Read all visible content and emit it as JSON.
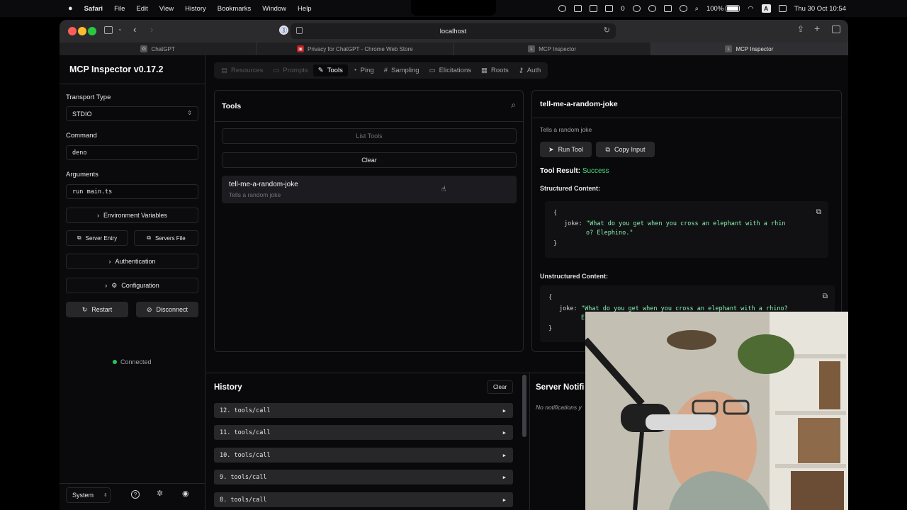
{
  "menubar": {
    "apple": "",
    "app_name": "Safari",
    "items": [
      "File",
      "Edit",
      "View",
      "History",
      "Bookmarks",
      "Window",
      "Help"
    ],
    "badge": "0",
    "battery": "100%",
    "input_source": "A",
    "clock": "Thu 30 Oct  10:54"
  },
  "safari": {
    "address": "localhost",
    "tabs": [
      {
        "label": "ChatGPT",
        "favicon": "G"
      },
      {
        "label": "Privacy for ChatGPT - Chrome Web Store",
        "favicon": "▣"
      },
      {
        "label": "MCP Inspector",
        "favicon": "L"
      },
      {
        "label": "MCP Inspector",
        "favicon": "L"
      }
    ]
  },
  "sidebar": {
    "title": "MCP Inspector v0.17.2",
    "transport_label": "Transport Type",
    "transport_value": "STDIO",
    "command_label": "Command",
    "command_value": "deno",
    "arguments_label": "Arguments",
    "arguments_value": "run main.ts",
    "env_vars": "Environment Variables",
    "server_entry": "Server Entry",
    "servers_file": "Servers File",
    "authentication": "Authentication",
    "configuration": "Configuration",
    "restart": "Restart",
    "disconnect": "Disconnect",
    "status": "Connected",
    "theme": "System"
  },
  "nav": {
    "tabs": [
      "Resources",
      "Prompts",
      "Tools",
      "Ping",
      "Sampling",
      "Elicitations",
      "Roots",
      "Auth"
    ]
  },
  "tools_panel": {
    "title": "Tools",
    "list_tools": "List Tools",
    "clear": "Clear",
    "tool_name": "tell-me-a-random-joke",
    "tool_desc": "Tells a random joke"
  },
  "detail": {
    "title": "tell-me-a-random-joke",
    "desc": "Tells a random joke",
    "run_tool": "Run Tool",
    "copy_input": "Copy Input",
    "result_label": "Tool Result:",
    "result_value": "Success",
    "structured_label": "Structured Content:",
    "unstructured_label": "Unstructured Content:",
    "brace_open": "{",
    "brace_close": "}",
    "joke_key": "joke:",
    "structured_line1": "\"What do you get when you cross an elephant with a rhin",
    "structured_line2": "o? Elephino.\"",
    "unstructured_line1": "\"What do you get when you cross an elephant with a rhino?",
    "unstructured_line2": "E"
  },
  "history": {
    "title": "History",
    "clear": "Clear",
    "rows": [
      "12. tools/call",
      "11. tools/call",
      "10. tools/call",
      "9. tools/call",
      "8. tools/call"
    ]
  },
  "notifications": {
    "title": "Server Notifi",
    "empty": "No notifications y"
  }
}
